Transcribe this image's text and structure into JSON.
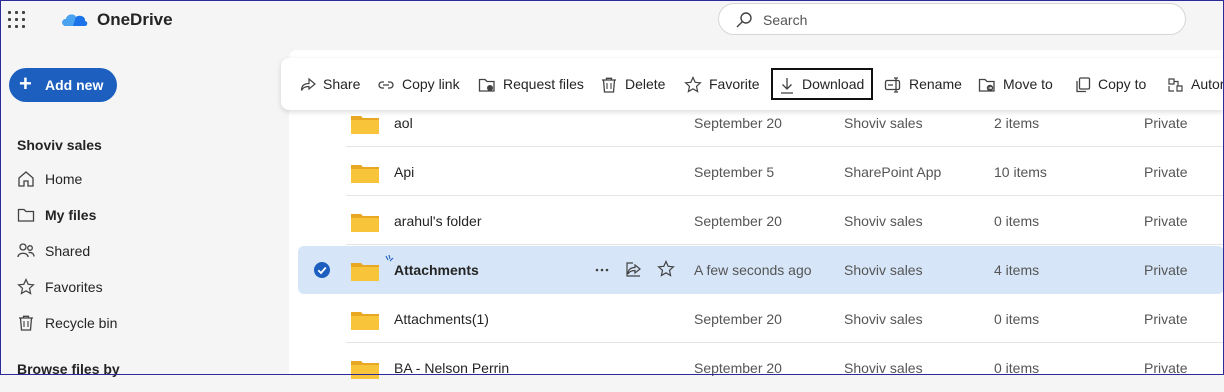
{
  "app": {
    "title": "OneDrive"
  },
  "search": {
    "placeholder": "Search"
  },
  "sidebar": {
    "add_new": "Add new",
    "section": "Shoviv sales",
    "items": [
      {
        "label": "Home",
        "icon": "home-icon"
      },
      {
        "label": "My files",
        "icon": "folder-icon",
        "active": true
      },
      {
        "label": "Shared",
        "icon": "people-icon"
      },
      {
        "label": "Favorites",
        "icon": "star-icon"
      },
      {
        "label": "Recycle bin",
        "icon": "trash-icon"
      }
    ],
    "browse_title": "Browse files by"
  },
  "toolbar": {
    "share": "Share",
    "copy_link": "Copy link",
    "request_files": "Request files",
    "delete": "Delete",
    "favorite": "Favorite",
    "download": "Download",
    "rename": "Rename",
    "move_to": "Move to",
    "copy_to": "Copy to",
    "automate": "Autor"
  },
  "rows": [
    {
      "name": "aol",
      "modified": "September 20",
      "modified_by": "Shoviv sales",
      "size": "2 items",
      "sharing": "Private"
    },
    {
      "name": "Api",
      "modified": "September 5",
      "modified_by": "SharePoint App",
      "size": "10 items",
      "sharing": "Private"
    },
    {
      "name": "arahul's folder",
      "modified": "September 20",
      "modified_by": "Shoviv sales",
      "size": "0 items",
      "sharing": "Private"
    },
    {
      "name": "Attachments",
      "modified": "A few seconds ago",
      "modified_by": "Shoviv sales",
      "size": "4 items",
      "sharing": "Private",
      "selected": true
    },
    {
      "name": "Attachments(1)",
      "modified": "September 20",
      "modified_by": "Shoviv sales",
      "size": "0 items",
      "sharing": "Private"
    },
    {
      "name": "BA - Nelson Perrin",
      "modified": "September 20",
      "modified_by": "Shoviv sales",
      "size": "0 items",
      "sharing": "Private"
    }
  ],
  "colors": {
    "accent": "#1c5fbf",
    "selected_row": "#d6e6f8",
    "folder": "#f8c53a"
  }
}
